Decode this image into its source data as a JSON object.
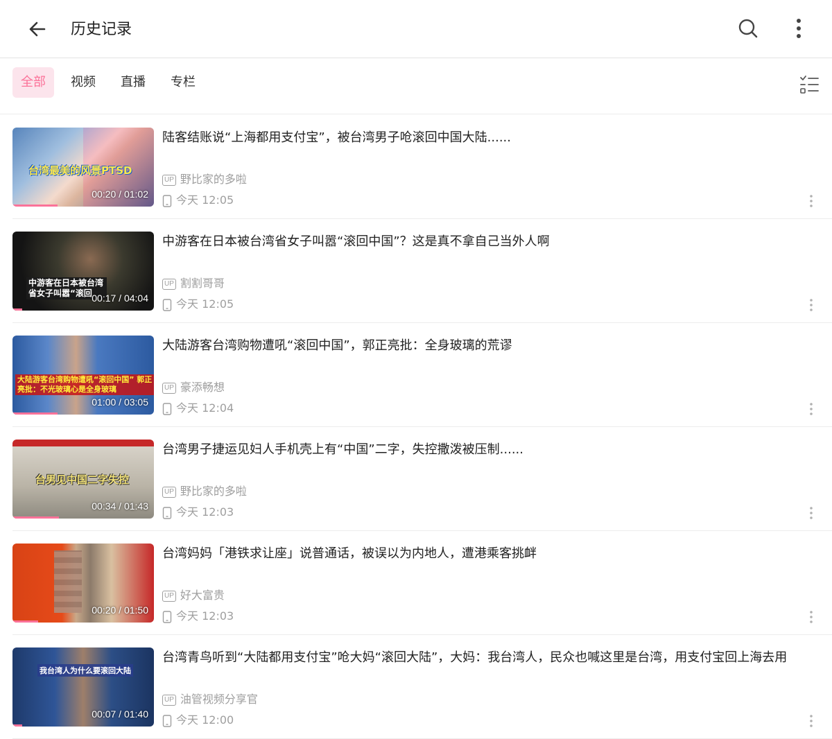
{
  "header": {
    "title": "历史记录"
  },
  "tabs": [
    {
      "label": "全部",
      "active": true
    },
    {
      "label": "视频",
      "active": false
    },
    {
      "label": "直播",
      "active": false
    },
    {
      "label": "专栏",
      "active": false
    }
  ],
  "accent_color": "#fb7299",
  "items": [
    {
      "title": "陆客结账说“上海都用支付宝”，被台湾男子呛滚回中国大陆......",
      "up": "野比家的多啦",
      "time": "今天 12:05",
      "duration": "00:20 / 01:02",
      "progress": 0.32,
      "caption": "台湾最美的风景PTSD"
    },
    {
      "title": "中游客在日本被台湾省女子叫嚣“滚回中国”？这是真不拿自己当外人啊",
      "up": "割割哥哥",
      "time": "今天 12:05",
      "duration": "00:17 / 04:04",
      "progress": 0.07,
      "caption": "中游客在日本被台湾省女子叫嚣“滚回"
    },
    {
      "title": "大陆游客台湾购物遭吼“滚回中国”，郭正亮批：全身玻璃的荒谬",
      "up": "豪添畅想",
      "time": "今天 12:04",
      "duration": "01:00 / 03:05",
      "progress": 0.32,
      "caption": "大陆游客台湾购物遭吼“滚回中国” 郭正亮批：不光玻璃心是全身玻璃"
    },
    {
      "title": "台湾男子捷运见妇人手机壳上有“中国”二字，失控撒泼被压制......",
      "up": "野比家的多啦",
      "time": "今天 12:03",
      "duration": "00:34 / 01:43",
      "progress": 0.33,
      "caption": "台男见中国二字失控"
    },
    {
      "title": "台湾妈妈「港铁求让座」说普通话，被误以为内地人，遭港乘客挑衅",
      "up": "好大富贵",
      "time": "今天 12:03",
      "duration": "00:20 / 01:50",
      "progress": 0.18,
      "caption": ""
    },
    {
      "title": "台湾青鸟听到“大陆都用支付宝”呛大妈“滚回大陆”，大妈：我台湾人，民众也喊这里是台湾，用支付宝回上海去用",
      "up": "油管视频分享官",
      "time": "今天 12:00",
      "duration": "00:07 / 01:40",
      "progress": 0.07,
      "caption": "我台湾人为什么要滚回大陆"
    }
  ]
}
